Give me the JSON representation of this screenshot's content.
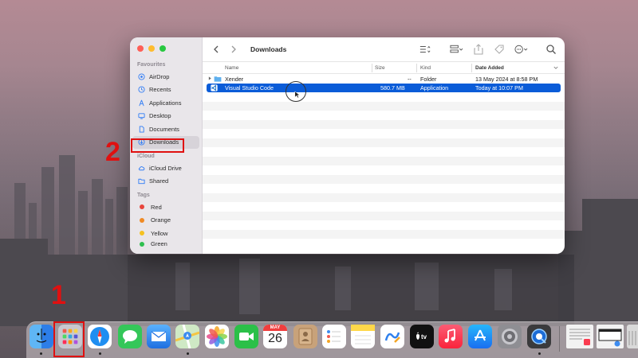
{
  "finder": {
    "title": "Downloads",
    "sidebar": {
      "favourites_label": "Favourites",
      "favourites": [
        {
          "label": "AirDrop",
          "icon": "airdrop-icon"
        },
        {
          "label": "Recents",
          "icon": "clock-icon"
        },
        {
          "label": "Applications",
          "icon": "applications-icon"
        },
        {
          "label": "Desktop",
          "icon": "desktop-icon"
        },
        {
          "label": "Documents",
          "icon": "document-icon"
        },
        {
          "label": "Downloads",
          "icon": "download-icon"
        }
      ],
      "icloud_label": "iCloud",
      "icloud": [
        {
          "label": "iCloud Drive",
          "icon": "cloud-icon"
        },
        {
          "label": "Shared",
          "icon": "shared-folder-icon"
        }
      ],
      "tags_label": "Tags",
      "tags": [
        {
          "label": "Red",
          "color": "#e8453c"
        },
        {
          "label": "Orange",
          "color": "#f08a24"
        },
        {
          "label": "Yellow",
          "color": "#f5c120"
        },
        {
          "label": "Green",
          "color": "#2fbf4f"
        }
      ]
    },
    "columns": {
      "name": "Name",
      "size": "Size",
      "kind": "Kind",
      "date": "Date Added"
    },
    "files": [
      {
        "name": "Xender",
        "size": "--",
        "kind": "Folder",
        "date": "13 May 2024 at 8:58 PM",
        "icon": "folder-icon"
      },
      {
        "name": "Visual Studio Code",
        "size": "580.7 MB",
        "kind": "Application",
        "date": "Today at 10:07 PM",
        "icon": "vscode-icon"
      }
    ]
  },
  "annotations": {
    "one": "1",
    "two": "2"
  },
  "dock": {
    "calendar_month": "MAY",
    "calendar_day": "26",
    "apps": [
      {
        "name": "finder-icon",
        "color": "#2d8cf0"
      },
      {
        "name": "launchpad-icon",
        "color": "#9aa0a8"
      },
      {
        "name": "safari-icon",
        "color": "#1f8ef1"
      },
      {
        "name": "messages-icon",
        "color": "#34c759"
      },
      {
        "name": "mail-icon",
        "color": "#2f80ed"
      },
      {
        "name": "maps-icon",
        "color": "#4cb860"
      },
      {
        "name": "photos-icon",
        "color": "#ffffff"
      },
      {
        "name": "facetime-icon",
        "color": "#2bc048"
      },
      {
        "name": "calendar-icon",
        "color": "#ffffff"
      },
      {
        "name": "contacts-icon",
        "color": "#c8a27a"
      },
      {
        "name": "reminders-icon",
        "color": "#ffffff"
      },
      {
        "name": "notes-icon",
        "color": "#ffd84a"
      },
      {
        "name": "freeform-icon",
        "color": "#ffffff"
      },
      {
        "name": "appletv-icon",
        "color": "#111111"
      },
      {
        "name": "music-icon",
        "color": "#fa3c50"
      },
      {
        "name": "appstore-icon",
        "color": "#1a8cf0"
      },
      {
        "name": "system-settings-icon",
        "color": "#8e8e93"
      },
      {
        "name": "quicktime-icon",
        "color": "#3a3a3c"
      },
      {
        "name": "recent-document-icon",
        "color": "#f2f2f2"
      },
      {
        "name": "recent-screenshot-icon",
        "color": "#f2f2f2"
      },
      {
        "name": "trash-icon",
        "color": "#d9d9d9"
      }
    ]
  }
}
